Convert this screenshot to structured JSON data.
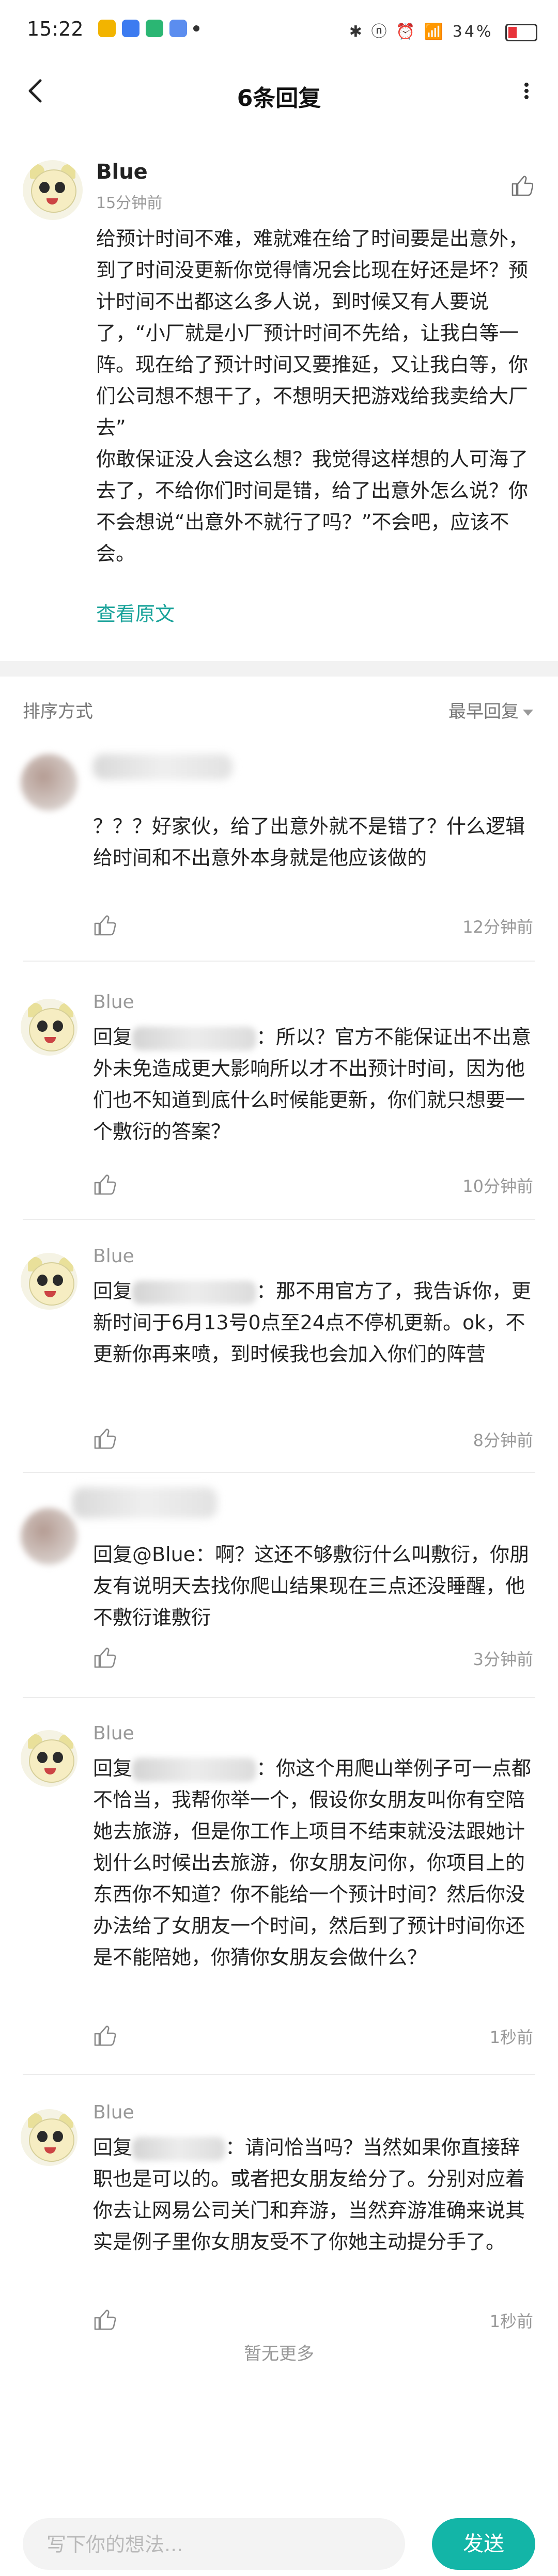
{
  "status_bar": {
    "time": "15:22",
    "right_text": "✱ ⓝ ⏰ 📶 34%",
    "battery_percent": 34
  },
  "nav": {
    "title": "6条回复"
  },
  "main_post": {
    "author": "Blue",
    "time": "15分钟前",
    "body": "给预计时间不难，难就难在给了时间要是出意外，到了时间没更新你觉得情况会比现在好还是坏？预计时间不出都这么多人说，到时候又有人要说了，“小厂就是小厂预计时间不先给，让我白等一阵。现在给了预计时间又要推延，又让我白等，你们公司想不想干了，不想明天把游戏给我卖给大厂去”\n你敢保证没人会这么想？我觉得这样想的人可海了去了，不给你们时间是错，给了出意外怎么说？你不会想说“出意外不就行了吗？”不会吧，应该不会。",
    "view_original": "查看原文"
  },
  "sort": {
    "label": "排序方式",
    "selected": "最早回复"
  },
  "replies": [
    {
      "author": "",
      "body": "？？？好家伙，给了出意外就不是错了？什么逻辑\n给时间和不出意外本身就是他应该做的",
      "time": "12分钟前"
    },
    {
      "author": "Blue",
      "reply_prefix": "回复",
      "body_after": "：所以？官方不能保证出不出意外未免造成更大影响所以才不出预计时间，因为他们也不知道到底什么时候能更新，你们就只想要一个敷衍的答案？",
      "time": "10分钟前"
    },
    {
      "author": "Blue",
      "reply_prefix": "回复",
      "body_after": "：那不用官方了，我告诉你，更新时间于6月13号0点至24点不停机更新。ok，不更新你再来喷，到时候我也会加入你们的阵营",
      "time": "8分钟前"
    },
    {
      "author": "",
      "body": "回复@Blue：啊？这还不够敷衍什么叫敷衍，你朋友有说明天去找你爬山结果现在三点还没睡醒，他不敷衍谁敷衍",
      "time": "3分钟前"
    },
    {
      "author": "Blue",
      "reply_prefix": "回复",
      "body_after": "：你这个用爬山举例子可一点都不恰当，我帮你举一个，假设你女朋友叫你有空陪她去旅游，但是你工作上项目不结束就没法跟她计划什么时候出去旅游，你女朋友问你，你项目上的东西你不知道？你不能给一个预计时间？然后你没办法给了女朋友一个时间，然后到了预计时间你还是不能陪她，你猜你女朋友会做什么？",
      "time": "1秒前"
    },
    {
      "author": "Blue",
      "reply_prefix": "回复",
      "body_after": "：请问恰当吗？当然如果你直接辞职也是可以的。或者把女朋友给分了。分别对应着你去让网易公司关门和弃游，当然弃游准确来说其实是例子里你女朋友受不了你她主动提分手了。",
      "time": "1秒前"
    }
  ],
  "no_more": "暂无更多",
  "composer": {
    "placeholder": "写下你的想法...",
    "send_label": "发送"
  },
  "colors": {
    "accent": "#13b5a7",
    "link": "#1aa39a",
    "muted": "#999999"
  }
}
